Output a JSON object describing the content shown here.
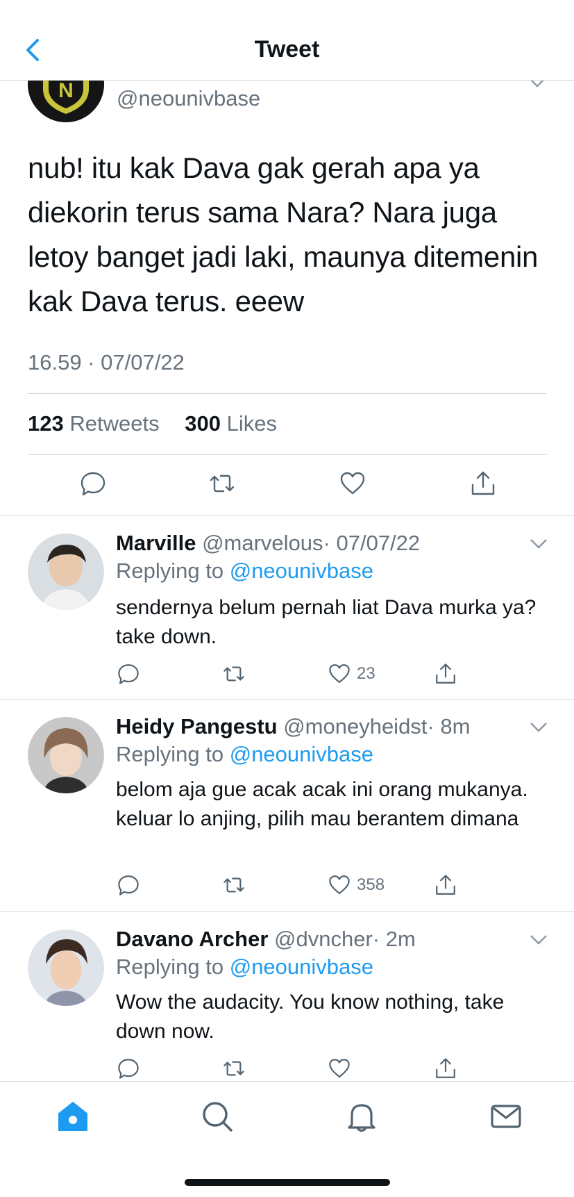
{
  "nav": {
    "title": "Tweet"
  },
  "main_tweet": {
    "handle": "@neounivbase",
    "text": "nub! itu kak Dava gak gerah apa ya diekorin terus sama Nara? Nara juga letoy banget jadi laki, maunya ditemenin kak Dava terus. eeew",
    "timestamp": "16.59 · 07/07/22",
    "retweets_count": "123",
    "retweets_label": "Retweets",
    "likes_count": "300",
    "likes_label": "Likes"
  },
  "replies": [
    {
      "name": "Marville",
      "handle": "@marvelous",
      "time": "· 07/07/22",
      "replying_label": "Replying to",
      "replying_to": "@neounivbase",
      "text": "sendernya belum pernah liat Dava murka ya? take down.",
      "likes": "23"
    },
    {
      "name": "Heidy Pangestu",
      "handle": "@moneyheidst",
      "time": "· 8m",
      "replying_label": "Replying to",
      "replying_to": "@neounivbase",
      "text": "belom aja gue acak acak ini orang mukanya. keluar lo anjing, pilih mau berantem dimana",
      "likes": "358"
    },
    {
      "name": "Davano Archer",
      "handle": "@dvncher",
      "time": "· 2m",
      "replying_label": "Replying to",
      "replying_to": "@neounivbase",
      "text": "Wow the audacity. You know nothing, take down now.",
      "likes": ""
    }
  ],
  "icons": {
    "back": "chevron-left-icon",
    "reply": "reply-bubble-icon",
    "retweet": "retweet-icon",
    "like": "heart-icon",
    "share": "share-icon",
    "tabs": [
      "home-icon",
      "search-icon",
      "bell-icon",
      "mail-icon"
    ]
  },
  "colors": {
    "accent": "#1d9bf0",
    "muted": "#66727d",
    "divider": "#d6d9dc"
  }
}
